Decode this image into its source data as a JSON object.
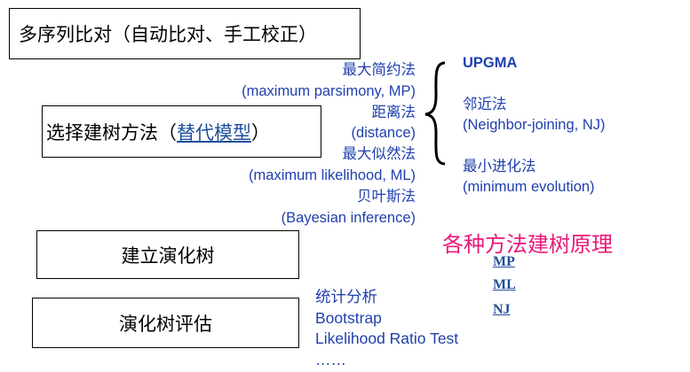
{
  "steps": {
    "msa": "多序列比对（自动比对、手工校正）",
    "choose_prefix": "选择建树方法（",
    "choose_link": "替代模型",
    "choose_suffix": "）",
    "build": "建立演化树",
    "evaluate": "演化树评估"
  },
  "methods": [
    "最大简约法",
    "(maximum parsimony, MP)",
    "距离法",
    "(distance)",
    "最大似然法",
    "(maximum likelihood, ML)",
    "贝叶斯法",
    "(Bayesian inference)"
  ],
  "distance_methods": {
    "upgma": "UPGMA",
    "nj_cn": "邻近法",
    "nj_en": "(Neighbor-joining, NJ)",
    "me_cn": "最小进化法",
    "me_en": "(minimum evolution)"
  },
  "principles": {
    "title": "各种方法建树原理",
    "links": [
      "MP",
      "ML",
      "NJ"
    ]
  },
  "evaluation": [
    "统计分析",
    "Bootstrap",
    "Likelihood Ratio Test",
    "……"
  ],
  "colors": {
    "method_text": "#1f3fae",
    "principle_title": "#e8197a",
    "link": "#1f4e9a"
  }
}
